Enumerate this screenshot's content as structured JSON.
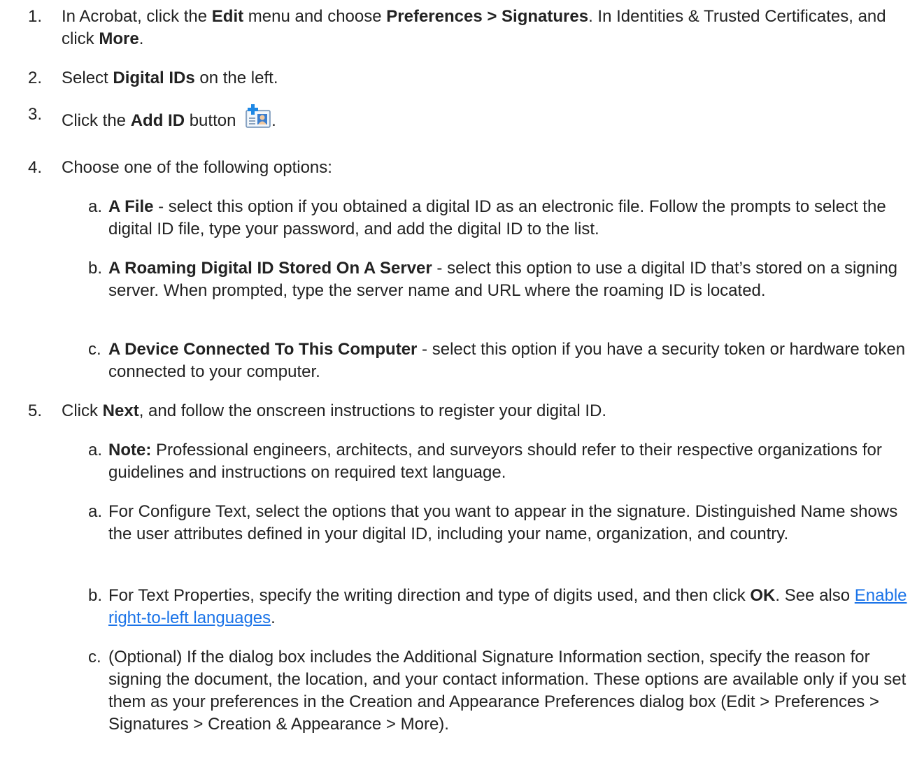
{
  "steps": [
    {
      "number": "1.",
      "parts": [
        "In Acrobat, click the ",
        "Edit",
        " menu and choose ",
        "Preferences > Signatures",
        ". In Identities & Trusted Certificates, and click ",
        "More",
        "."
      ]
    },
    {
      "number": "2.",
      "parts": [
        "Select ",
        "Digital IDs",
        " on the left."
      ]
    },
    {
      "number": "3.",
      "parts": [
        "Click the ",
        "Add ID",
        " button ",
        "."
      ],
      "icon": "add-id-icon"
    },
    {
      "number": "4.",
      "text": "Choose one of the following options:",
      "subs": [
        {
          "letter": "a.",
          "bold": "A File",
          "text": " - select this option if you obtained a digital ID as an electronic file. Follow the prompts to select the digital ID file, type your password, and add the digital ID to the list."
        },
        {
          "letter": "b.",
          "bold": "A Roaming Digital ID Stored On A Server",
          "text": " - select this option to use a digital ID that’s stored on a signing server. When prompted, type the server name and URL where the roaming ID is located."
        },
        {
          "letter": "c.",
          "bold": "A Device Connected To This Computer",
          "text": " - select this option if you have a security token or hardware token connected to your computer."
        }
      ]
    },
    {
      "number": "5.",
      "parts": [
        "Click ",
        "Next",
        ", and follow the onscreen instructions to register your digital ID."
      ],
      "subs": [
        {
          "letter": "a.",
          "bold": "Note:",
          "text": " Professional engineers, architects, and surveyors should refer to their respective organizations for guidelines and instructions on required text language."
        },
        {
          "letter": "a.",
          "text": "For Configure Text, select the options that you want to appear in the signature. Distinguished Name shows the user attributes defined in your digital ID, including your name, organization, and country."
        },
        {
          "letter": "b.",
          "parts": [
            "For Text Properties, specify the writing direction and type of digits used, and then click ",
            "OK",
            ". See also ",
            "Enable right-to-left languages",
            "."
          ]
        },
        {
          "letter": "c.",
          "text": "(Optional) If the dialog box includes the Additional Signature Information section, specify the reason for signing the document, the location, and your contact information. These options are available only if you set them as your preferences in the Creation and Appearance Preferences dialog box (Edit > Preferences > Signatures > Creation & Appearance > More)."
        }
      ]
    }
  ],
  "colors": {
    "text": "#222222",
    "link": "#1a73e8"
  }
}
